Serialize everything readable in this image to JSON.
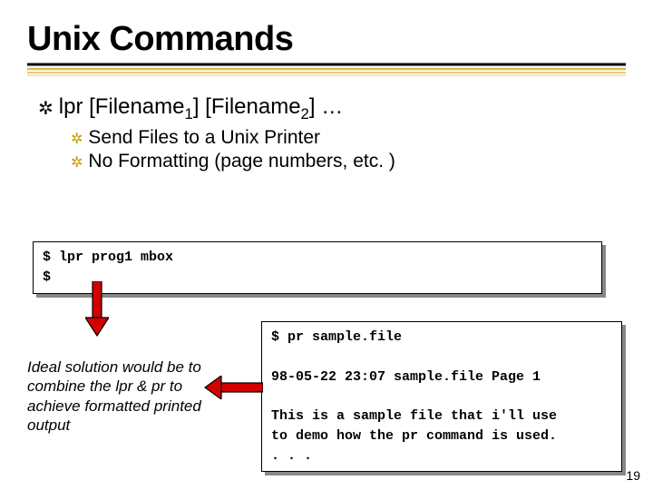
{
  "title": "Unix Commands",
  "bullets": {
    "l1": "lpr [Filename",
    "l1_sub1": "1",
    "l1_mid": "] [Filename",
    "l1_sub2": "2",
    "l1_end": "] …",
    "l2a": "Send Files to a Unix Printer",
    "l2b": "No Formatting (page numbers, etc. )"
  },
  "code1": "$ lpr prog1 mbox\n$",
  "code2": "$ pr sample.file\n\n98-05-22 23:07 sample.file Page 1\n\nThis is a sample file that i'll use\nto demo how the pr command is used.\n. . .",
  "note": "Ideal solution would be to combine the lpr & pr to achieve formatted printed output",
  "pagenum": "19",
  "colors": {
    "arrow_red": "#d40000",
    "arrow_stroke": "#000",
    "bullet_yellow": "#c59a00",
    "divider_yellow": "#e0b040"
  }
}
